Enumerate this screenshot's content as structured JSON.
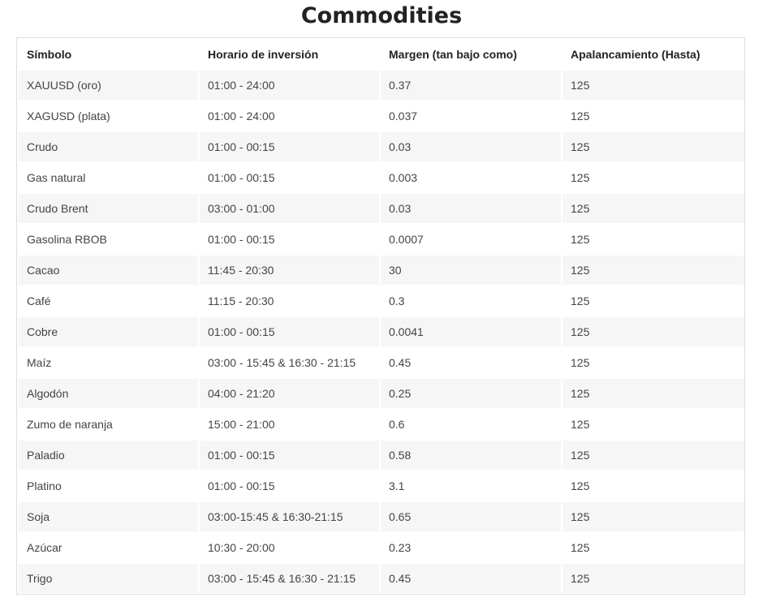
{
  "page": {
    "title": "Commodities"
  },
  "table": {
    "headers": [
      "Símbolo",
      "Horario de inversión",
      "Margen (tan bajo como)",
      "Apalancamiento (Hasta)"
    ],
    "rows": [
      [
        "XAUUSD (oro)",
        "01:00 - 24:00",
        "0.37",
        "125"
      ],
      [
        "XAGUSD (plata)",
        "01:00 - 24:00",
        "0.037",
        "125"
      ],
      [
        "Crudo",
        "01:00 - 00:15",
        "0.03",
        "125"
      ],
      [
        "Gas natural",
        "01:00 - 00:15",
        "0.003",
        "125"
      ],
      [
        "Crudo Brent",
        "03:00 - 01:00",
        "0.03",
        "125"
      ],
      [
        "Gasolina RBOB",
        "01:00 - 00:15",
        "0.0007",
        "125"
      ],
      [
        "Cacao",
        "11:45 - 20:30",
        "30",
        "125"
      ],
      [
        "Café",
        "11:15 - 20:30",
        "0.3",
        "125"
      ],
      [
        "Cobre",
        "01:00 - 00:15",
        "0.0041",
        "125"
      ],
      [
        "Maíz",
        "03:00 - 15:45 & 16:30 - 21:15",
        "0.45",
        "125"
      ],
      [
        "Algodón",
        "04:00 - 21:20",
        "0.25",
        "125"
      ],
      [
        "Zumo de naranja",
        "15:00 - 21:00",
        "0.6",
        "125"
      ],
      [
        "Paladio",
        "01:00 - 00:15",
        "0.58",
        "125"
      ],
      [
        "Platino",
        "01:00 - 00:15",
        "3.1",
        "125"
      ],
      [
        "Soja",
        "03:00-15:45 & 16:30-21:15",
        "0.65",
        "125"
      ],
      [
        "Azúcar",
        "10:30 - 20:00",
        "0.23",
        "125"
      ],
      [
        "Trigo",
        "03:00 - 15:45 & 16:30 - 21:15",
        "0.45",
        "125"
      ]
    ]
  }
}
